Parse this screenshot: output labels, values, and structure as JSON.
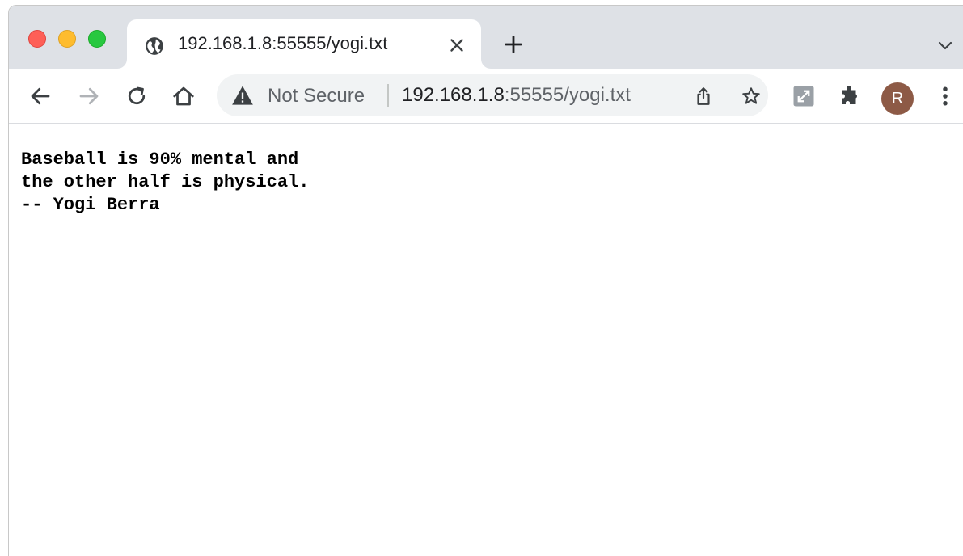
{
  "tab": {
    "title": "192.168.1.8:55555/yogi.txt",
    "favicon": "globe-icon"
  },
  "toolbar": {
    "security_label": "Not Secure",
    "url_host": "192.168.1.8",
    "url_rest": ":55555/yogi.txt",
    "profile_initial": "R"
  },
  "icons": {
    "back": "arrow-left-icon",
    "forward": "arrow-right-icon",
    "reload": "reload-icon",
    "home": "home-icon",
    "warning": "warning-triangle-icon",
    "share": "share-icon",
    "bookmark": "star-icon",
    "extension_1": "extension-icon",
    "extensions": "puzzle-icon",
    "menu": "kebab-menu-icon"
  },
  "colors": {
    "tabstrip_bg": "#dee1e6",
    "omnibox_bg": "#f1f3f4",
    "avatar_bg": "#8d5a46",
    "close_red": "#fe5f57",
    "minimize_yellow": "#febc2e",
    "zoom_green": "#28c840"
  },
  "page": {
    "lines": [
      "Baseball is 90% mental and",
      "the other half is physical.",
      "-- Yogi Berra"
    ]
  }
}
